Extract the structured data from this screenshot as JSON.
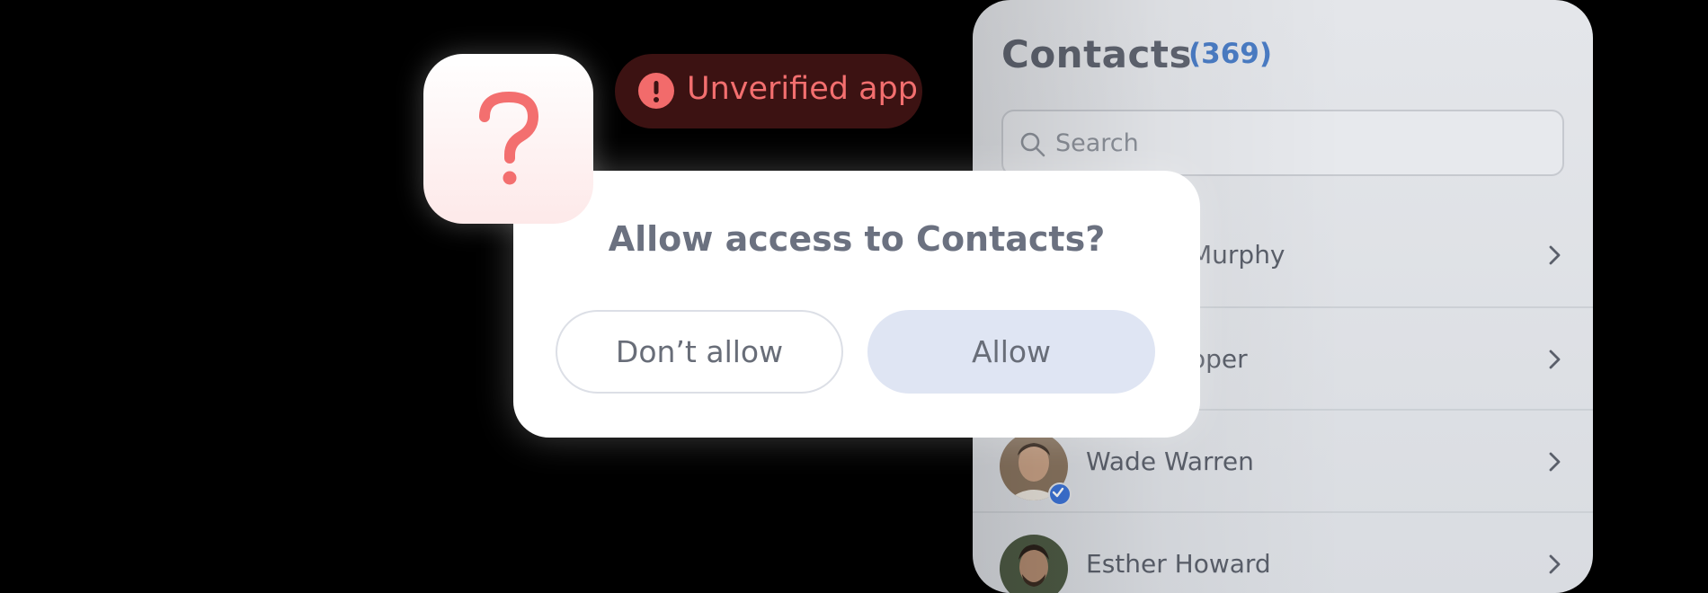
{
  "contacts": {
    "title": "Contacts",
    "count": "(369)",
    "search_placeholder": "Search",
    "rows": [
      {
        "name": "Murphy"
      },
      {
        "name": "oper"
      },
      {
        "name": "Wade Warren"
      },
      {
        "name": "Esther Howard"
      }
    ]
  },
  "badge": {
    "label": "Unverified app",
    "icon": "alert-circle-icon"
  },
  "app_icon": {
    "icon": "question-mark-icon"
  },
  "dialog": {
    "title": "Allow access to Contacts?",
    "deny_label": "Don’t allow",
    "allow_label": "Allow"
  },
  "colors": {
    "accent": "#4a7cc4",
    "warning": "#f26b6b",
    "badge_bg": "#3c1212",
    "allow_button_bg": "#dfe5f3"
  }
}
